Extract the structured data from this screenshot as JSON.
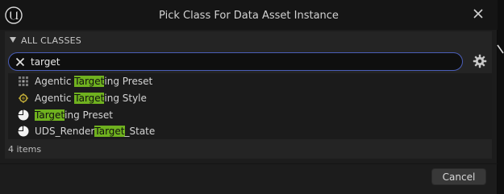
{
  "dialog": {
    "title": "Pick Class For Data Asset Instance",
    "logo_icon": "unreal-engine-logo-icon",
    "close_icon": "close-icon"
  },
  "section": {
    "label": "ALL CLASSES",
    "arrow_icon": "triangle-down-icon"
  },
  "search": {
    "value": "target",
    "placeholder": "",
    "clear_icon": "clear-x-icon",
    "settings_icon": "gear-icon"
  },
  "results": [
    {
      "pre": "Agentic ",
      "match": "Target",
      "post": "ing Preset",
      "icon": "grid-node-icon"
    },
    {
      "pre": "Agentic ",
      "match": "Target",
      "post": "ing Style",
      "icon": "orb-node-icon"
    },
    {
      "pre": "",
      "match": "Target",
      "post": "ing Preset",
      "icon": "pie-chart-icon"
    },
    {
      "pre": "UDS_Render",
      "match": "Target",
      "post": "_State",
      "icon": "pie-chart-icon"
    }
  ],
  "item_count": "4 items",
  "footer": {
    "cancel_label": "Cancel"
  },
  "colors": {
    "highlight": "#6fb11f",
    "search_border": "#4a5eb8",
    "orb_icon": "#c8b23a",
    "grid_icon": "#7a7a7a"
  }
}
